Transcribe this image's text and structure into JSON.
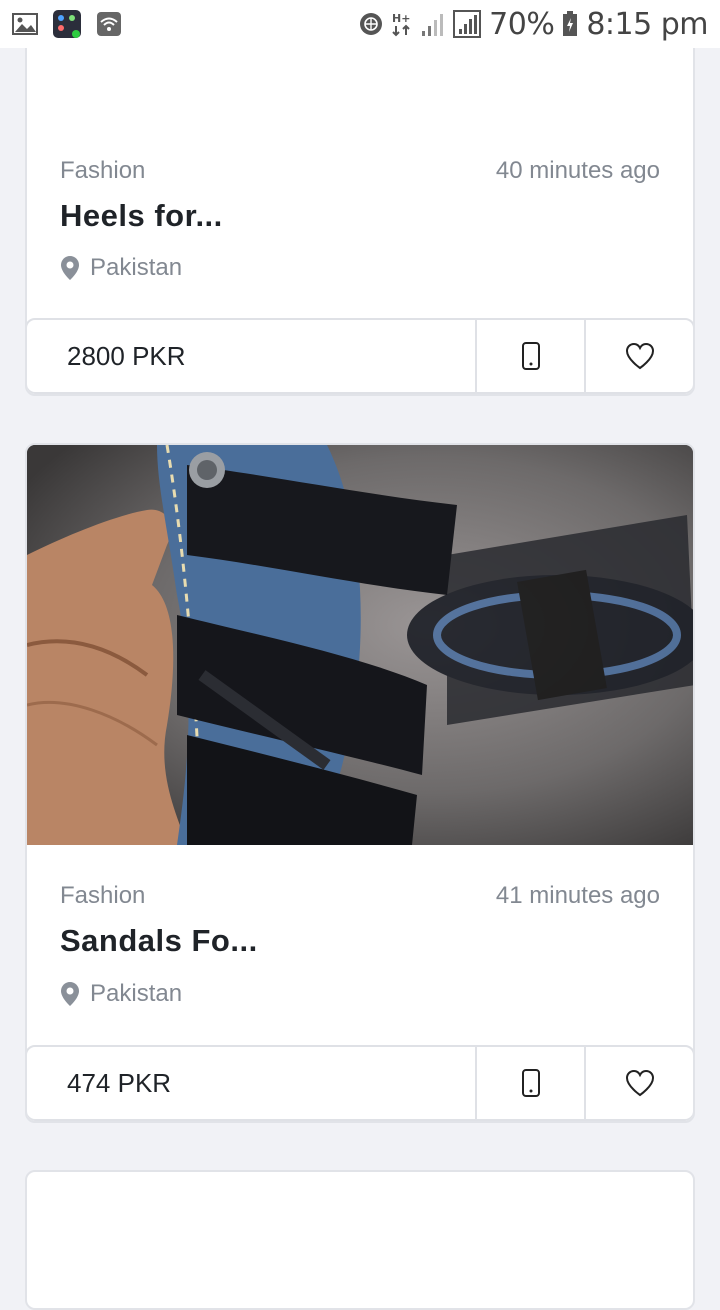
{
  "status_bar": {
    "icons_left": [
      "gallery-icon",
      "app-grid-icon",
      "wifi-icon"
    ],
    "icons_right": [
      "vpn-globe-icon",
      "network-h-plus-icon",
      "signal-icon",
      "signal-icon"
    ],
    "battery": "70%",
    "time": "8:15 pm"
  },
  "listings": [
    {
      "category": "Fashion",
      "time_ago": "40 minutes ago",
      "title": "Heels for...",
      "location": "Pakistan",
      "price": "2800 PKR"
    },
    {
      "category": "Fashion",
      "time_ago": "41 minutes ago",
      "title": "Sandals Fo...",
      "location": "Pakistan",
      "price": "474 PKR"
    }
  ],
  "colors": {
    "background": "#f1f2f6",
    "card": "#ffffff",
    "muted_text": "#828891",
    "title_text": "#1f2328",
    "border": "#dfe1e6"
  }
}
